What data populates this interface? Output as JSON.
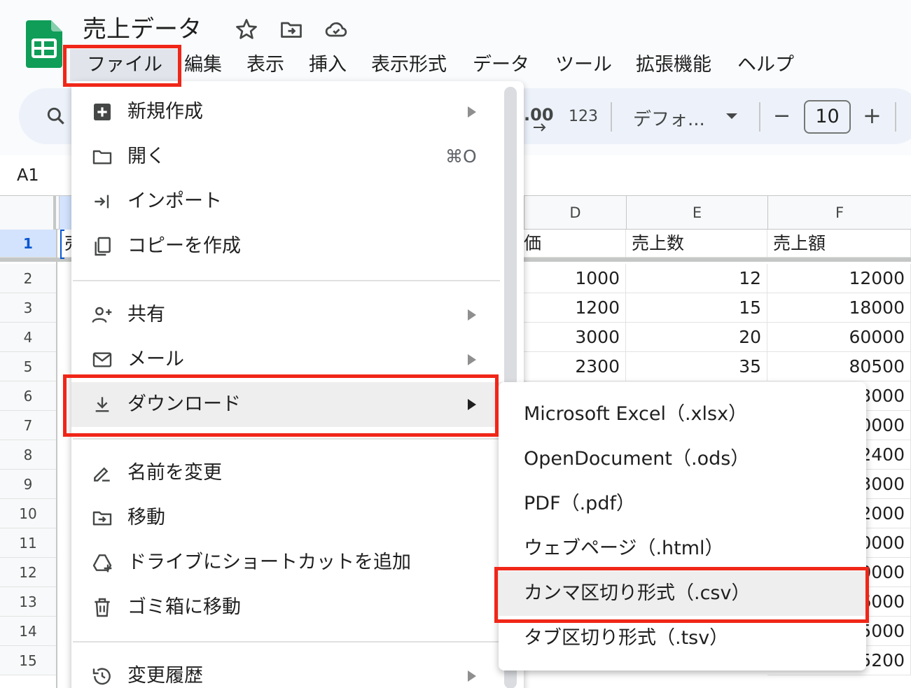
{
  "doc": {
    "title": "売上データ"
  },
  "menubar": [
    "ファイル",
    "編集",
    "表示",
    "挿入",
    "表示形式",
    "データ",
    "ツール",
    "拡張機能",
    "ヘルプ"
  ],
  "toolbar": {
    "decimal": ".00",
    "number_format": "123",
    "font": "デフォ...",
    "font_size": "10",
    "minus": "−",
    "plus": "+"
  },
  "sheet": {
    "name_box": "A1",
    "columns": [
      "D",
      "E",
      "F"
    ],
    "rows": [
      "1",
      "2",
      "3",
      "4",
      "5",
      "6",
      "7",
      "8",
      "9",
      "10",
      "11",
      "12",
      "13",
      "14",
      "15"
    ],
    "a1_partial": "売",
    "d1_partial": "価",
    "header": {
      "e": "売上数",
      "f": "売上額"
    },
    "data": [
      {
        "d": "1000",
        "e": "12",
        "f": "12000"
      },
      {
        "d": "1200",
        "e": "15",
        "f": "18000"
      },
      {
        "d": "3000",
        "e": "20",
        "f": "60000"
      },
      {
        "d": "2300",
        "e": "35",
        "f": "80500"
      }
    ],
    "f_partial": [
      "3000",
      "0000",
      "2400",
      "3000",
      "2000",
      "0000",
      "0000",
      "6000",
      "5000",
      "5200"
    ]
  },
  "file_menu": {
    "new": "新規作成",
    "open": "開く",
    "open_shortcut": "⌘O",
    "import": "インポート",
    "copy": "コピーを作成",
    "share": "共有",
    "email": "メール",
    "download": "ダウンロード",
    "rename": "名前を変更",
    "move": "移動",
    "shortcut": "ドライブにショートカットを追加",
    "trash": "ゴミ箱に移動",
    "history": "変更履歴"
  },
  "download_submenu": [
    "Microsoft Excel（.xlsx）",
    "OpenDocument（.ods）",
    "PDF（.pdf）",
    "ウェブページ（.html）",
    "カンマ区切り形式（.csv）",
    "タブ区切り形式（.tsv）"
  ],
  "colors": {
    "highlight": "#f02618",
    "sheets_green": "#0f9d58",
    "selection_blue": "#d3e3fd"
  }
}
